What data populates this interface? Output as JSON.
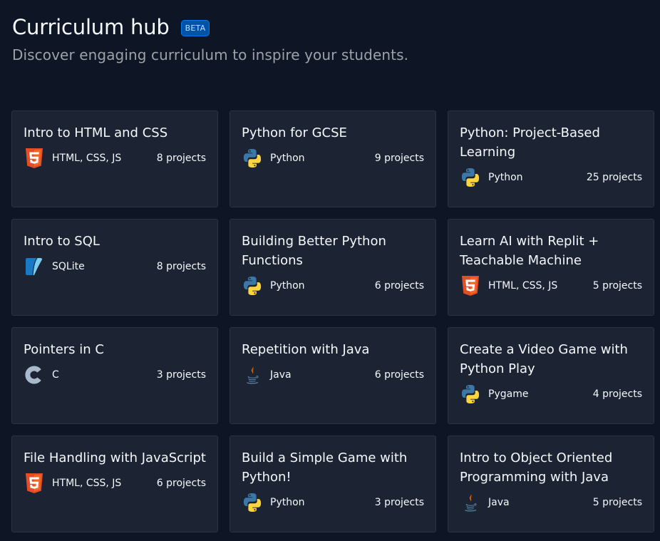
{
  "header": {
    "title": "Curriculum hub",
    "badge": "BETA",
    "subtitle": "Discover engaging curriculum to inspire your students."
  },
  "cards": [
    {
      "title": "Intro to HTML and CSS",
      "icon": "html5-icon",
      "language": "HTML, CSS, JS",
      "count": "8 projects"
    },
    {
      "title": "Python for GCSE",
      "icon": "python-icon",
      "language": "Python",
      "count": "9 projects"
    },
    {
      "title": "Python: Project-Based Learning",
      "icon": "python-icon",
      "language": "Python",
      "count": "25 projects"
    },
    {
      "title": "Intro to SQL",
      "icon": "sqlite-icon",
      "language": "SQLite",
      "count": "8 projects"
    },
    {
      "title": "Building Better Python Functions",
      "icon": "python-icon",
      "language": "Python",
      "count": "6 projects"
    },
    {
      "title": "Learn AI with Replit + Teachable Machine",
      "icon": "html5-icon",
      "language": "HTML, CSS, JS",
      "count": "5 projects"
    },
    {
      "title": "Pointers in C",
      "icon": "c-language-icon",
      "language": "C",
      "count": "3 projects"
    },
    {
      "title": "Repetition with Java",
      "icon": "java-icon",
      "language": "Java",
      "count": "6 projects"
    },
    {
      "title": "Create a Video Game with Python Play",
      "icon": "python-icon",
      "language": "Pygame",
      "count": "4 projects"
    },
    {
      "title": "File Handling with JavaScript",
      "icon": "html5-icon",
      "language": "HTML, CSS, JS",
      "count": "6 projects"
    },
    {
      "title": "Build a Simple Game with Python!",
      "icon": "python-icon",
      "language": "Python",
      "count": "3 projects"
    },
    {
      "title": "Intro to Object Oriented Programming with Java",
      "icon": "java-icon",
      "language": "Java",
      "count": "5 projects"
    }
  ],
  "colors": {
    "background": "#0e1525",
    "card": "#1c2333",
    "card_border": "#2b3245",
    "badge": "#0053a6",
    "subtitle": "#9da2a6"
  }
}
